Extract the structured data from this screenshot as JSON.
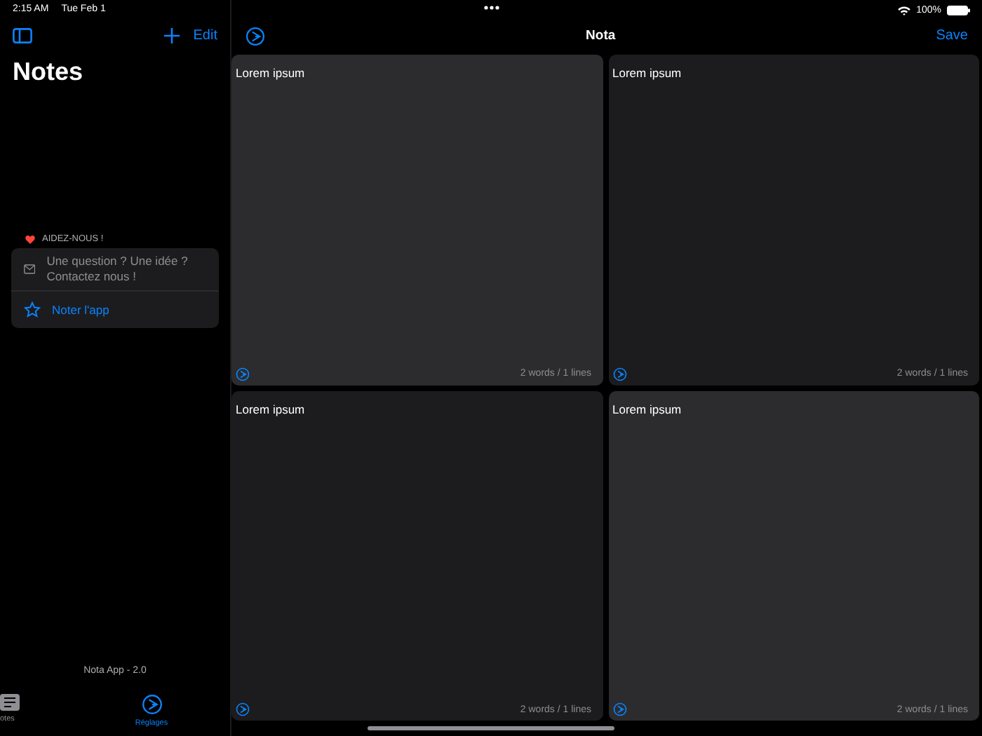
{
  "status_bar": {
    "time": "2:15 AM",
    "date": "Tue Feb 1",
    "battery": "100%"
  },
  "sidebar": {
    "edit_label": "Edit",
    "title": "Notes",
    "section_header": "AIDEZ-NOUS !",
    "help_items": [
      {
        "kind": "contact",
        "label": "Une question ? Une idée ? Contactez nous !"
      },
      {
        "kind": "rate",
        "label": "Noter l'app"
      }
    ],
    "version": "Nota App - 2.0"
  },
  "tab_bar": [
    {
      "label": "otes",
      "kind": "notes",
      "selected": false
    },
    {
      "label": "Réglages",
      "kind": "settings",
      "selected": true
    }
  ],
  "main": {
    "title": "Nota",
    "save_label": "Save",
    "cards": [
      {
        "text": "Lorem ipsum",
        "footer": "2 words / 1 lines",
        "kind": "light"
      },
      {
        "text": "Lorem ipsum",
        "footer": "2 words / 1 lines",
        "kind": "dark"
      },
      {
        "text": "Lorem ipsum",
        "footer": "2 words / 1 lines",
        "kind": "dark"
      },
      {
        "text": "Lorem ipsum",
        "footer": "2 words / 1 lines",
        "kind": "light"
      }
    ]
  }
}
